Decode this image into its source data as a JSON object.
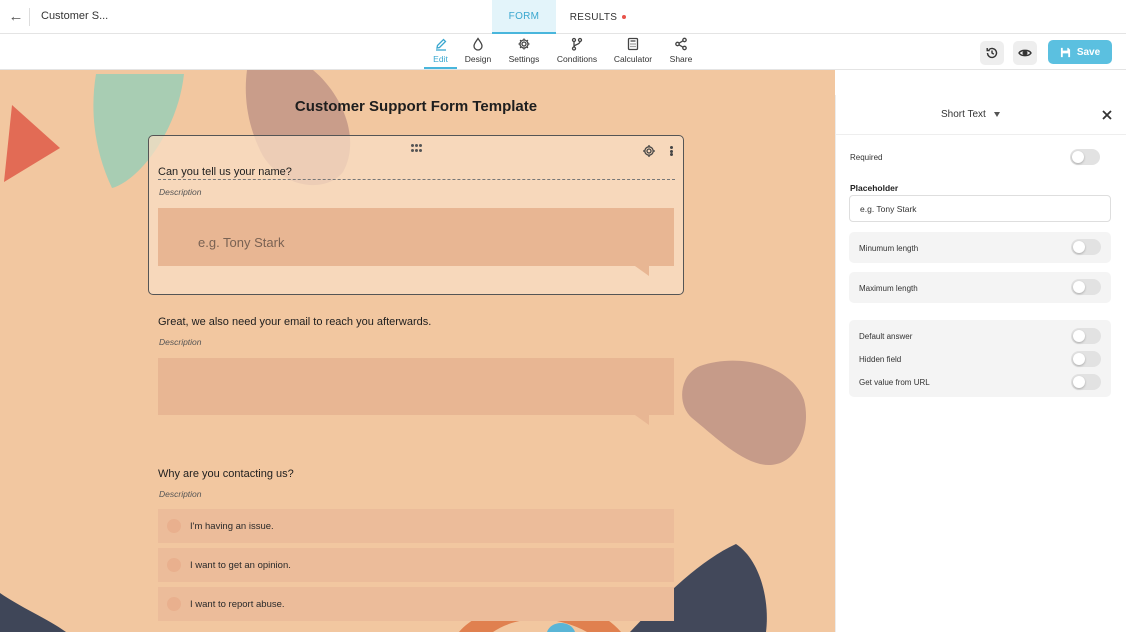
{
  "topbar": {
    "back_icon": "arrow-left-icon",
    "doc_title": "Customer S...",
    "tabs": [
      {
        "label": "FORM",
        "active": true
      },
      {
        "label": "RESULTS",
        "badge_color": "#e8534a"
      }
    ]
  },
  "toolbar": {
    "tools": [
      {
        "label": "Edit",
        "icon": "droplet-pen-icon",
        "active": true
      },
      {
        "label": "Design",
        "icon": "droplet-icon"
      },
      {
        "label": "Settings",
        "icon": "gear-icon"
      },
      {
        "label": "Conditions",
        "icon": "branch-icon"
      },
      {
        "label": "Calculator",
        "icon": "calculator-icon"
      },
      {
        "label": "Share",
        "icon": "share-icon"
      }
    ],
    "history_icon": "history-icon",
    "preview_icon": "eye-icon",
    "save_label": "Save",
    "accent": "#49b6dc"
  },
  "form": {
    "title": "Customer Support Form Template",
    "background_color": "#f2c7a0",
    "questions": [
      {
        "label": "Can you tell us your name?",
        "description": "Description",
        "placeholder": "e.g. Tony Stark"
      },
      {
        "label": "Great, we also need your email to reach you afterwards.",
        "description": "Description"
      },
      {
        "label": "Why are you contacting us?",
        "description": "Description",
        "choices": [
          "I'm having an issue.",
          "I want to get an opinion.",
          "I want to report abuse."
        ]
      }
    ]
  },
  "panel": {
    "field_type": "Short Text",
    "required_label": "Required",
    "placeholder_label": "Placeholder",
    "placeholder_value": "e.g. Tony Stark",
    "min_length_label": "Minumum length",
    "max_length_label": "Maximum length",
    "default_answer_label": "Default answer",
    "hidden_field_label": "Hidden field",
    "url_value_label": "Get value from URL"
  }
}
